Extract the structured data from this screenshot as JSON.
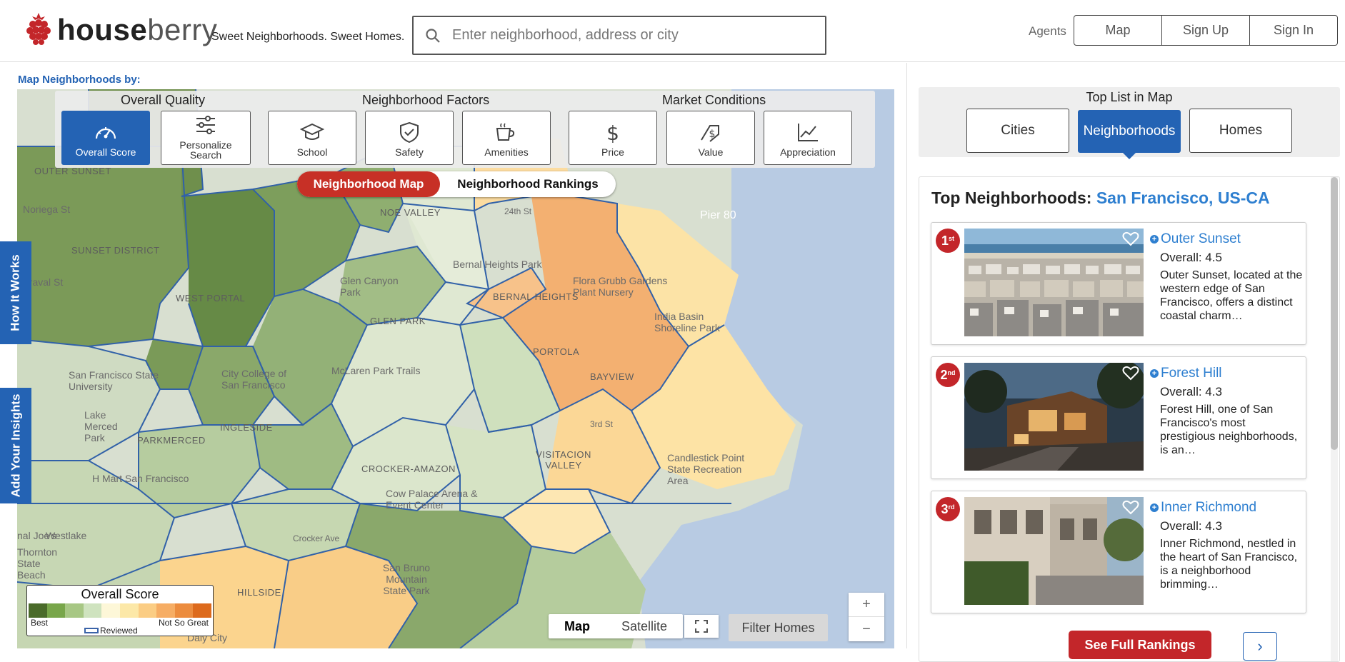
{
  "header": {
    "logo_house": "house",
    "logo_berry": "berry",
    "tagline": "Sweet Neighborhoods. Sweet Homes.",
    "search_placeholder": "Enter neighborhood, address or city",
    "agents_label": "Agents",
    "nav": {
      "map": "Map",
      "signup": "Sign Up",
      "signin": "Sign In"
    }
  },
  "map_section": {
    "map_by_label": "Map Neighborhoods by:",
    "groups": {
      "overall_quality": "Overall Quality",
      "neighborhood_factors": "Neighborhood Factors",
      "market_conditions": "Market Conditions"
    },
    "tools": {
      "overall_score": "Overall Score",
      "personalize_search": "Personalize Search",
      "school": "School",
      "safety": "Safety",
      "amenities": "Amenities",
      "price": "Price",
      "value": "Value",
      "appreciation": "Appreciation"
    },
    "toggle": {
      "map": "Neighborhood Map",
      "rankings": "Neighborhood Rankings"
    },
    "labels": {
      "outer_sunset": "OUTER SUNSET",
      "sunset_district": "SUNSET DISTRICT",
      "noriega": "Noriega St",
      "taraval": "Taraval St",
      "west_portal": "WEST PORTAL",
      "noe_valley": "NOE VALLEY",
      "glen_canyon": "Glen Canyon Park",
      "glen_park": "GLEN PARK",
      "bernal_heights": "BERNAL HEIGHTS",
      "bernal_park": "Bernal Heights Park",
      "portola": "PORTOLA",
      "bayview": "BAYVIEW",
      "india_basin": "India Basin Shoreline Park",
      "flora_grubb": "Flora Grubb Gardens Plant Nursery",
      "pier80": "Pier 80",
      "sfsu": "San Francisco State University",
      "lake_merced": "Lake Merced Park",
      "city_college": "City College of San Francisco",
      "ingleside": "INGLESIDE",
      "mclaren": "McLaren Park Trails",
      "parkmerced": "PARKMERCED",
      "crocker_amazon": "CROCKER-AMAZON",
      "visitacion": "VISITACION VALLEY",
      "candlestick": "Candlestick Point State Recreation Area",
      "hmart": "H Mart San Francisco",
      "cow_palace": "Cow Palace Arena & Event Center",
      "westlake": "Westlake",
      "thornton": "Thornton State Beach",
      "joes": "nal Joe's",
      "san_bruno": "San Bruno Mountain State Park",
      "hillside": "HILLSIDE",
      "daly_city": "Daly City",
      "crocker_ave": "Crocker Ave",
      "st24": "24th St",
      "third_st": "3rd St"
    },
    "legend": {
      "title": "Overall Score",
      "best": "Best",
      "not_so_great": "Not So Great",
      "reviewed": "Reviewed",
      "colors": [
        "#4a6b2a",
        "#78a64a",
        "#a7c784",
        "#cfe3bf",
        "#fdf7d8",
        "#fce8a8",
        "#fbcd84",
        "#f6ad64",
        "#ec8c3e",
        "#dd6a1c"
      ]
    },
    "map_type": {
      "map": "Map",
      "satellite": "Satellite"
    },
    "filter_homes": "Filter Homes",
    "zoom": {
      "in": "+",
      "out": "−"
    },
    "side_tabs": {
      "how": "How It Works",
      "insights": "Add Your Insights"
    }
  },
  "top_list": {
    "title": "Top List in Map",
    "tabs": {
      "cities": "Cities",
      "neighborhoods": "Neighborhoods",
      "homes": "Homes"
    }
  },
  "rankings": {
    "title": "Top Neighborhoods:",
    "city": "San Francisco, US-CA",
    "items": [
      {
        "rank": "1",
        "suffix": "st",
        "name": "Outer Sunset",
        "score": "Overall: 4.5",
        "desc": "Outer Sunset, located at the western edge of San Francisco, offers a distinct coastal charm…"
      },
      {
        "rank": "2",
        "suffix": "nd",
        "name": "Forest Hill",
        "score": "Overall: 4.3",
        "desc": "Forest Hill, one of San Francisco's most prestigious neighborhoods, is an…"
      },
      {
        "rank": "3",
        "suffix": "rd",
        "name": "Inner Richmond",
        "score": "Overall: 4.3",
        "desc": "Inner Richmond, nestled in the heart of San Francisco, is a neighborhood brimming…"
      }
    ],
    "see_full": "See Full Rankings",
    "next": "›"
  },
  "colors": {
    "brand_blue": "#2463b4",
    "brand_red": "#c3262a",
    "link_blue": "#2e7fd0"
  }
}
